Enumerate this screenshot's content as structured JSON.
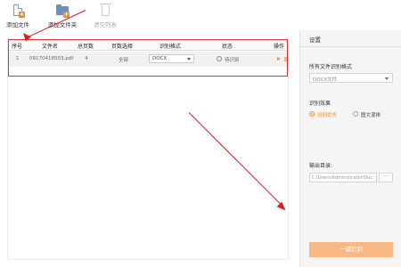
{
  "toolbar": {
    "add_file_label": "添加文件",
    "add_folder_label": "添加文件夹",
    "clear_list_label": "清空列表"
  },
  "table": {
    "headers": [
      "序号",
      "文件名",
      "总页数",
      "页数选择",
      "识别格式",
      "状态",
      "操作"
    ],
    "rows": [
      {
        "index": "1",
        "filename": "09170418503.pdf",
        "pages": "4",
        "page_selection": "全部",
        "format": "DOCX",
        "status": "待识别"
      }
    ]
  },
  "settings": {
    "title": "设置",
    "all_format_label": "所有文件识别格式",
    "all_format_value": "DOCX文件",
    "effect_label": "识别效果",
    "effect_options": [
      "识别优先",
      "图文混排"
    ],
    "effect_selected": "识别优先",
    "output_label": "输出目录:",
    "output_path": "C:\\Users\\Administrator\\Doc",
    "browse_label": "···",
    "start_label": "一键识别"
  },
  "colors": {
    "accent": "#f28a1c",
    "start_button": "#f8b886",
    "annotation": "#e03030"
  }
}
